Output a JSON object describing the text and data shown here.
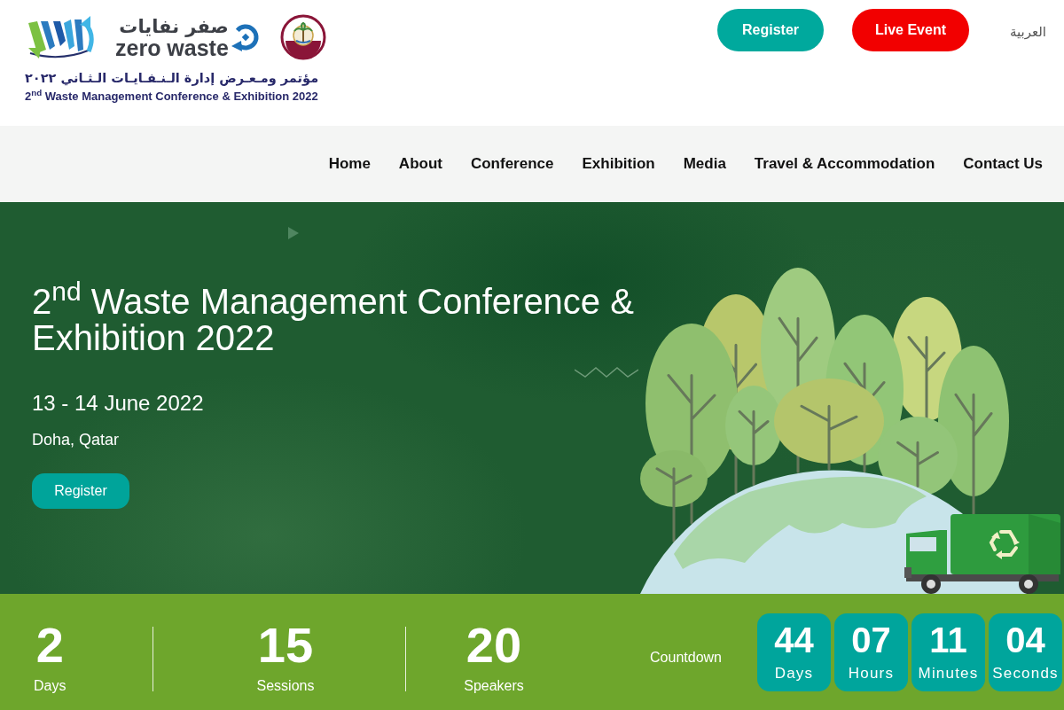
{
  "header": {
    "logo": {
      "arabic_name": "صفر نفايات",
      "name": "zero waste"
    },
    "event_title_arabic": "مؤتمر ومـعـرض إدارة الـنـفـايـات الـثـاني ٢٠٢٢",
    "event_title": "2$^{nd}$ Waste Management Conference & Exhibition 2022",
    "buttons": [
      {
        "label": "Register",
        "kind": "register"
      },
      {
        "label": "Live Event",
        "kind": "live"
      }
    ],
    "language_link": "العربية"
  },
  "nav": {
    "items": [
      "Home",
      "About",
      "Conference",
      "Exhibition",
      "Media",
      "Travel & Accommodation",
      "Contact Us"
    ]
  },
  "hero": {
    "title": "2$^{nd}$ Waste Management Conference & Exhibition 2022",
    "date": "13 - 14 June 2022",
    "location": "Doha, Qatar",
    "button": "Register"
  },
  "stats": [
    {
      "value": "2",
      "label": "Days"
    },
    {
      "value": "15",
      "label": "Sessions"
    },
    {
      "value": "20",
      "label": "Speakers"
    }
  ],
  "countdown": {
    "label": "Countdown",
    "units": [
      {
        "value": "44",
        "label": "Days"
      },
      {
        "value": "07",
        "label": "Hours"
      },
      {
        "value": "11",
        "label": "Minutes"
      },
      {
        "value": "04",
        "label": "Seconds"
      }
    ]
  }
}
